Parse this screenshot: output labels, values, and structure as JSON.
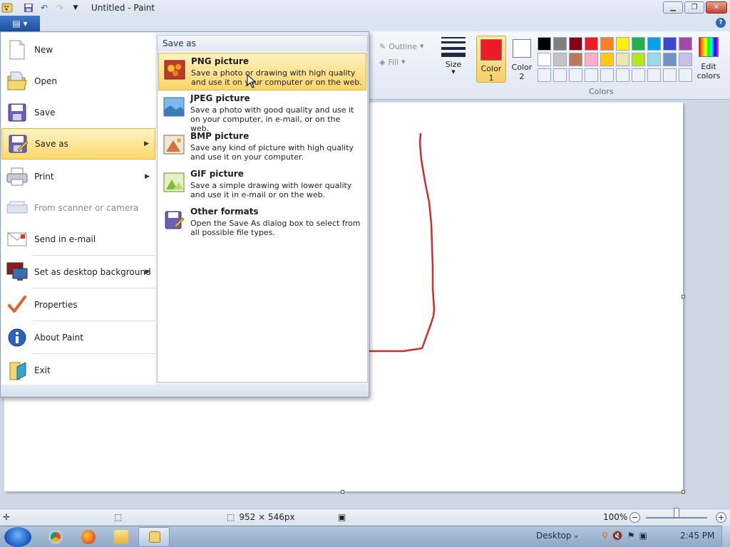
{
  "window": {
    "title": "Untitled - Paint"
  },
  "ribbon": {
    "outline_label": "Outline",
    "fill_label": "Fill",
    "size_label": "Size",
    "color1_label": "Color\n1",
    "color1_value": "#ed1c24",
    "color2_label": "Color\n2",
    "color2_value": "#ffffff",
    "edit_colors_label": "Edit\ncolors",
    "colors_group_label": "Colors",
    "palette_row1": [
      "#000000",
      "#7f7f7f",
      "#880015",
      "#ed1c24",
      "#ff7f27",
      "#fff200",
      "#22b14c",
      "#00a2e8",
      "#3f48cc",
      "#a349a4"
    ],
    "palette_row2": [
      "#ffffff",
      "#c3c3c3",
      "#b97a57",
      "#ffaec9",
      "#ffc90e",
      "#efe4b0",
      "#b5e61d",
      "#99d9ea",
      "#7092be",
      "#c8bfe7"
    ]
  },
  "file_menu": {
    "items": [
      {
        "label": "New",
        "icon": "new-document-icon"
      },
      {
        "label": "Open",
        "icon": "open-folder-icon"
      },
      {
        "label": "Save",
        "icon": "save-disk-icon"
      },
      {
        "label": "Save as",
        "icon": "save-as-icon"
      },
      {
        "label": "Print",
        "icon": "printer-icon"
      },
      {
        "label": "From scanner or camera",
        "icon": "scanner-icon"
      },
      {
        "label": "Send in e-mail",
        "icon": "email-icon"
      },
      {
        "label": "Set as desktop background",
        "icon": "desktop-background-icon"
      },
      {
        "label": "Properties",
        "icon": "properties-check-icon"
      },
      {
        "label": "About Paint",
        "icon": "info-icon"
      },
      {
        "label": "Exit",
        "icon": "exit-icon"
      }
    ],
    "submenu": {
      "header": "Save as",
      "items": [
        {
          "title": "PNG picture",
          "desc": "Save a photo or drawing with high quality and use it on your computer or on the web.",
          "icon": "png-picture-icon"
        },
        {
          "title": "JPEG picture",
          "desc": "Save a photo with good quality and use it on your computer, in e-mail, or on the web.",
          "icon": "jpeg-picture-icon"
        },
        {
          "title": "BMP picture",
          "desc": "Save any kind of picture with high quality and use it on your computer.",
          "icon": "bmp-picture-icon"
        },
        {
          "title": "GIF picture",
          "desc": "Save a simple drawing with lower quality and use it in e-mail or on the web.",
          "icon": "gif-picture-icon"
        },
        {
          "title": "Other formats",
          "desc": "Open the Save As dialog box to select from all possible file types.",
          "icon": "other-formats-icon"
        }
      ]
    }
  },
  "statusbar": {
    "dimensions": "952 × 546px",
    "zoom": "100%",
    "zoom_level": 1.0
  },
  "taskbar": {
    "desktop_label": "Desktop",
    "clock": "2:45 PM"
  },
  "drawing": {
    "stroke_color": "#d42a2a"
  }
}
